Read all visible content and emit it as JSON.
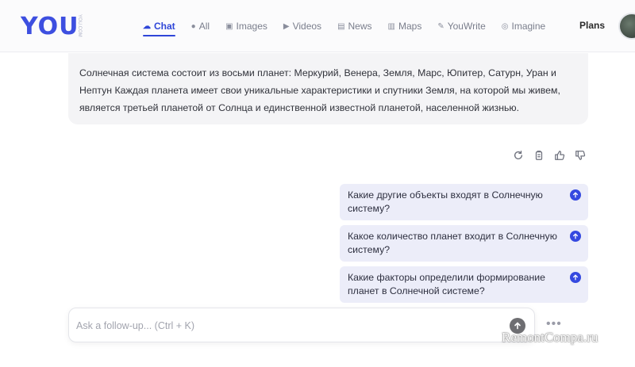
{
  "brand": {
    "logo_text": "YOU",
    "logo_sup": "YOU.COM"
  },
  "nav": {
    "items": [
      {
        "label": "Chat",
        "icon": "chat-bubble-icon",
        "glyph": "☁",
        "active": true
      },
      {
        "label": "All",
        "icon": "search-circle-icon",
        "glyph": "●",
        "active": false
      },
      {
        "label": "Images",
        "icon": "image-icon",
        "glyph": "▣",
        "active": false
      },
      {
        "label": "Videos",
        "icon": "play-circle-icon",
        "glyph": "▶",
        "active": false
      },
      {
        "label": "News",
        "icon": "newspaper-icon",
        "glyph": "▤",
        "active": false
      },
      {
        "label": "Maps",
        "icon": "map-icon",
        "glyph": "▥",
        "active": false
      },
      {
        "label": "YouWrite",
        "icon": "pencil-icon",
        "glyph": "✎",
        "active": false
      },
      {
        "label": "Imagine",
        "icon": "palette-icon",
        "glyph": "◎",
        "active": false
      }
    ],
    "plans_label": "Plans"
  },
  "answer": {
    "text": "Солнечная система состоит из восьми планет: Меркурий, Венера, Земля, Марс, Юпитер, Сатурн, Уран и Нептун Каждая планета имеет свои уникальные характеристики и спутники Земля, на которой мы живем, является третьей планетой от Солнца и единственной известной планетой, населенной жизнью."
  },
  "actions": [
    "refresh-icon",
    "copy-icon",
    "thumbs-up-icon",
    "thumbs-down-icon"
  ],
  "suggestions": [
    "Какие другие объекты входят в Солнечную систему?",
    "Какое количество планет входит в Солнечную систему?",
    "Какие факторы определили формирование планет в Солнечной системе?"
  ],
  "input": {
    "placeholder": "Ask a follow-up... (Ctrl + K)",
    "value": ""
  },
  "more_label": "•••",
  "watermark": "RemontCompa.ru",
  "colors": {
    "accent": "#3549e0",
    "suggestion_bg": "#ecedf9",
    "answer_bg": "#f4f4f6"
  }
}
